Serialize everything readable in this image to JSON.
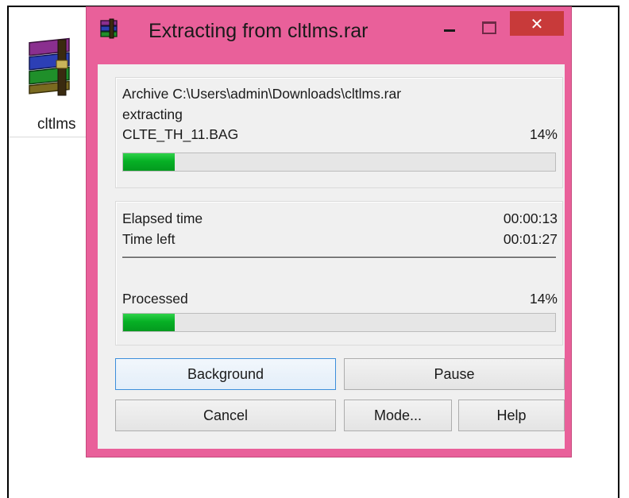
{
  "desktop": {
    "file_label": "cltlms"
  },
  "window": {
    "title": "Extracting from cltlms.rar",
    "close_symbol": "✕",
    "accent_color": "#e9609a",
    "close_color": "#c83a3a"
  },
  "progress_top": {
    "archive_line": "Archive C:\\Users\\admin\\Downloads\\cltlms.rar",
    "action": "extracting",
    "current_file": "CLTE_TH_11.BAG",
    "percent_label": "14%",
    "fraction": 0.14
  },
  "timing": {
    "elapsed_label": "Elapsed time",
    "elapsed_value": "00:00:13",
    "left_label": "Time left",
    "left_value": "00:01:27"
  },
  "processed": {
    "label": "Processed",
    "percent_label": "14%",
    "fraction": 0.14
  },
  "buttons": {
    "background": "Background",
    "pause": "Pause",
    "cancel": "Cancel",
    "mode": "Mode...",
    "help": "Help"
  },
  "icons": [
    "winrar-archive-icon",
    "winrar-title-icon",
    "minimize-icon",
    "maximize-icon",
    "close-icon"
  ]
}
